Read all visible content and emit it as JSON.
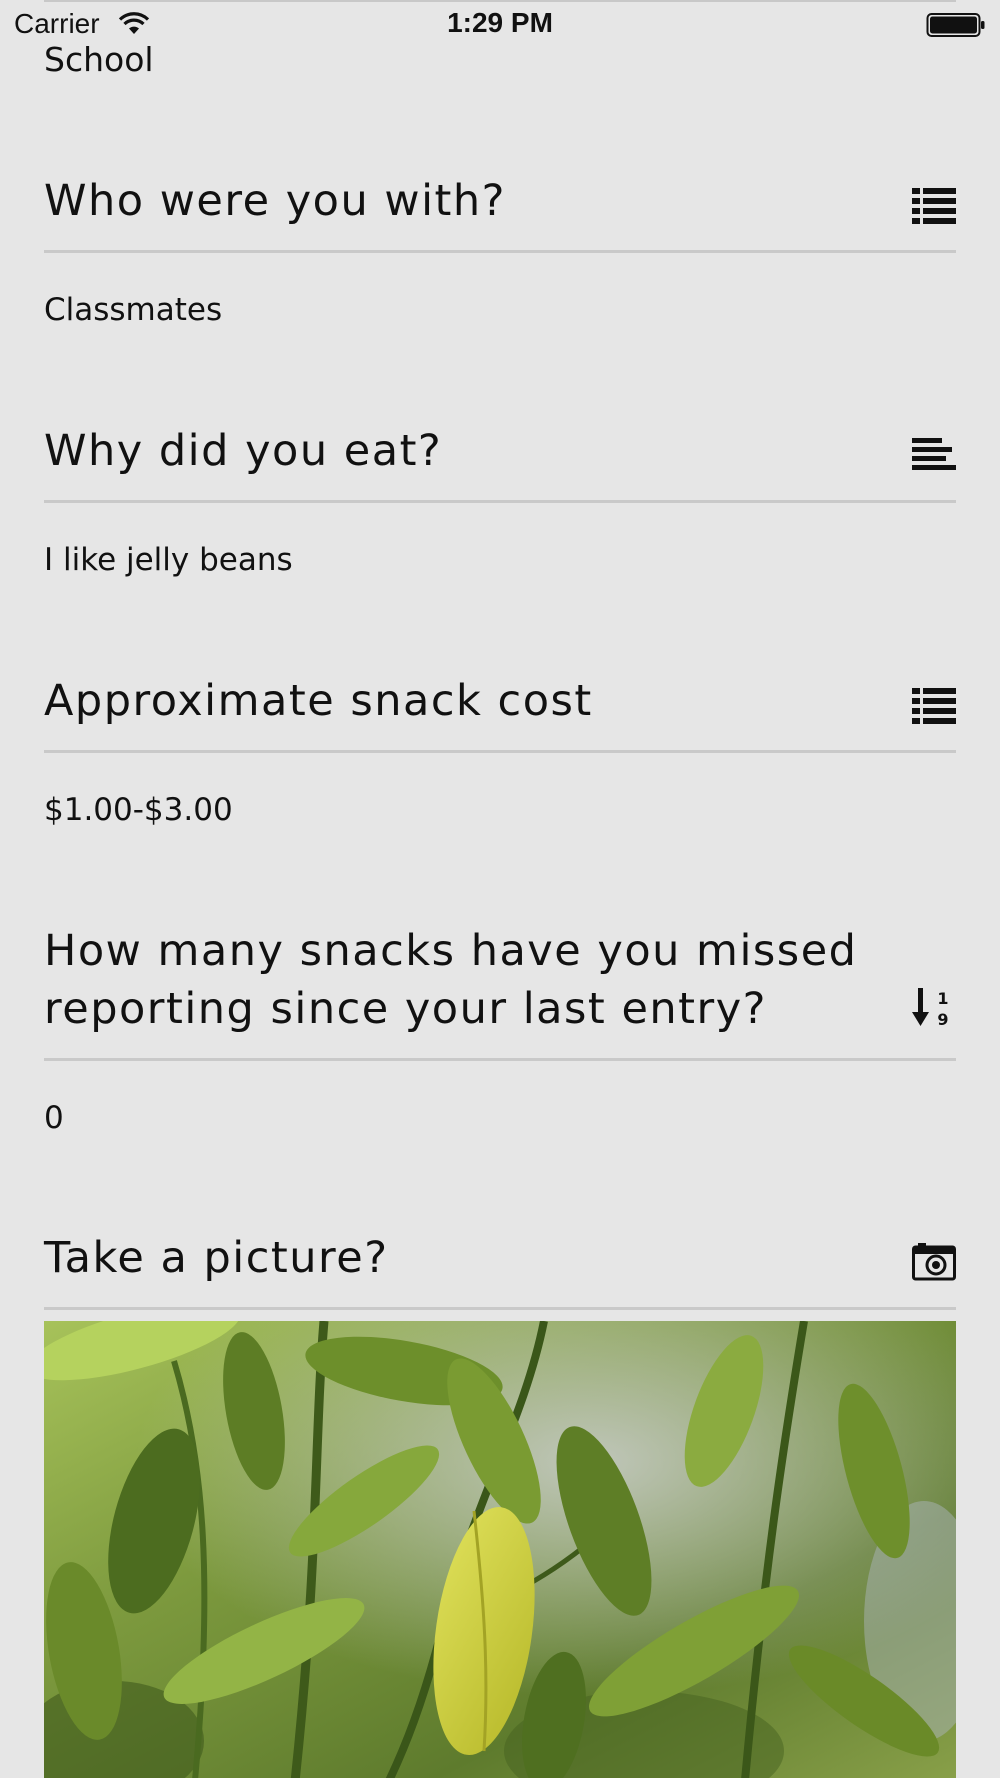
{
  "status_bar": {
    "carrier": "Carrier",
    "time": "1:29 PM"
  },
  "previous_answer": "School",
  "questions": [
    {
      "title": "Who were you with?",
      "icon": "list-icon",
      "answer": "Classmates"
    },
    {
      "title": "Why did you eat?",
      "icon": "text-lines-icon",
      "answer": "I like jelly beans"
    },
    {
      "title": "Approximate snack cost",
      "icon": "list-icon",
      "answer": "$1.00-$3.00"
    },
    {
      "title_line1": "How many snacks have you missed",
      "title_line2": "reporting since your last entry?",
      "icon": "numeric-sort-icon",
      "answer": "0"
    },
    {
      "title": "Take a picture?",
      "icon": "camera-icon",
      "answer_image": "photo of green plant leaves"
    }
  ]
}
